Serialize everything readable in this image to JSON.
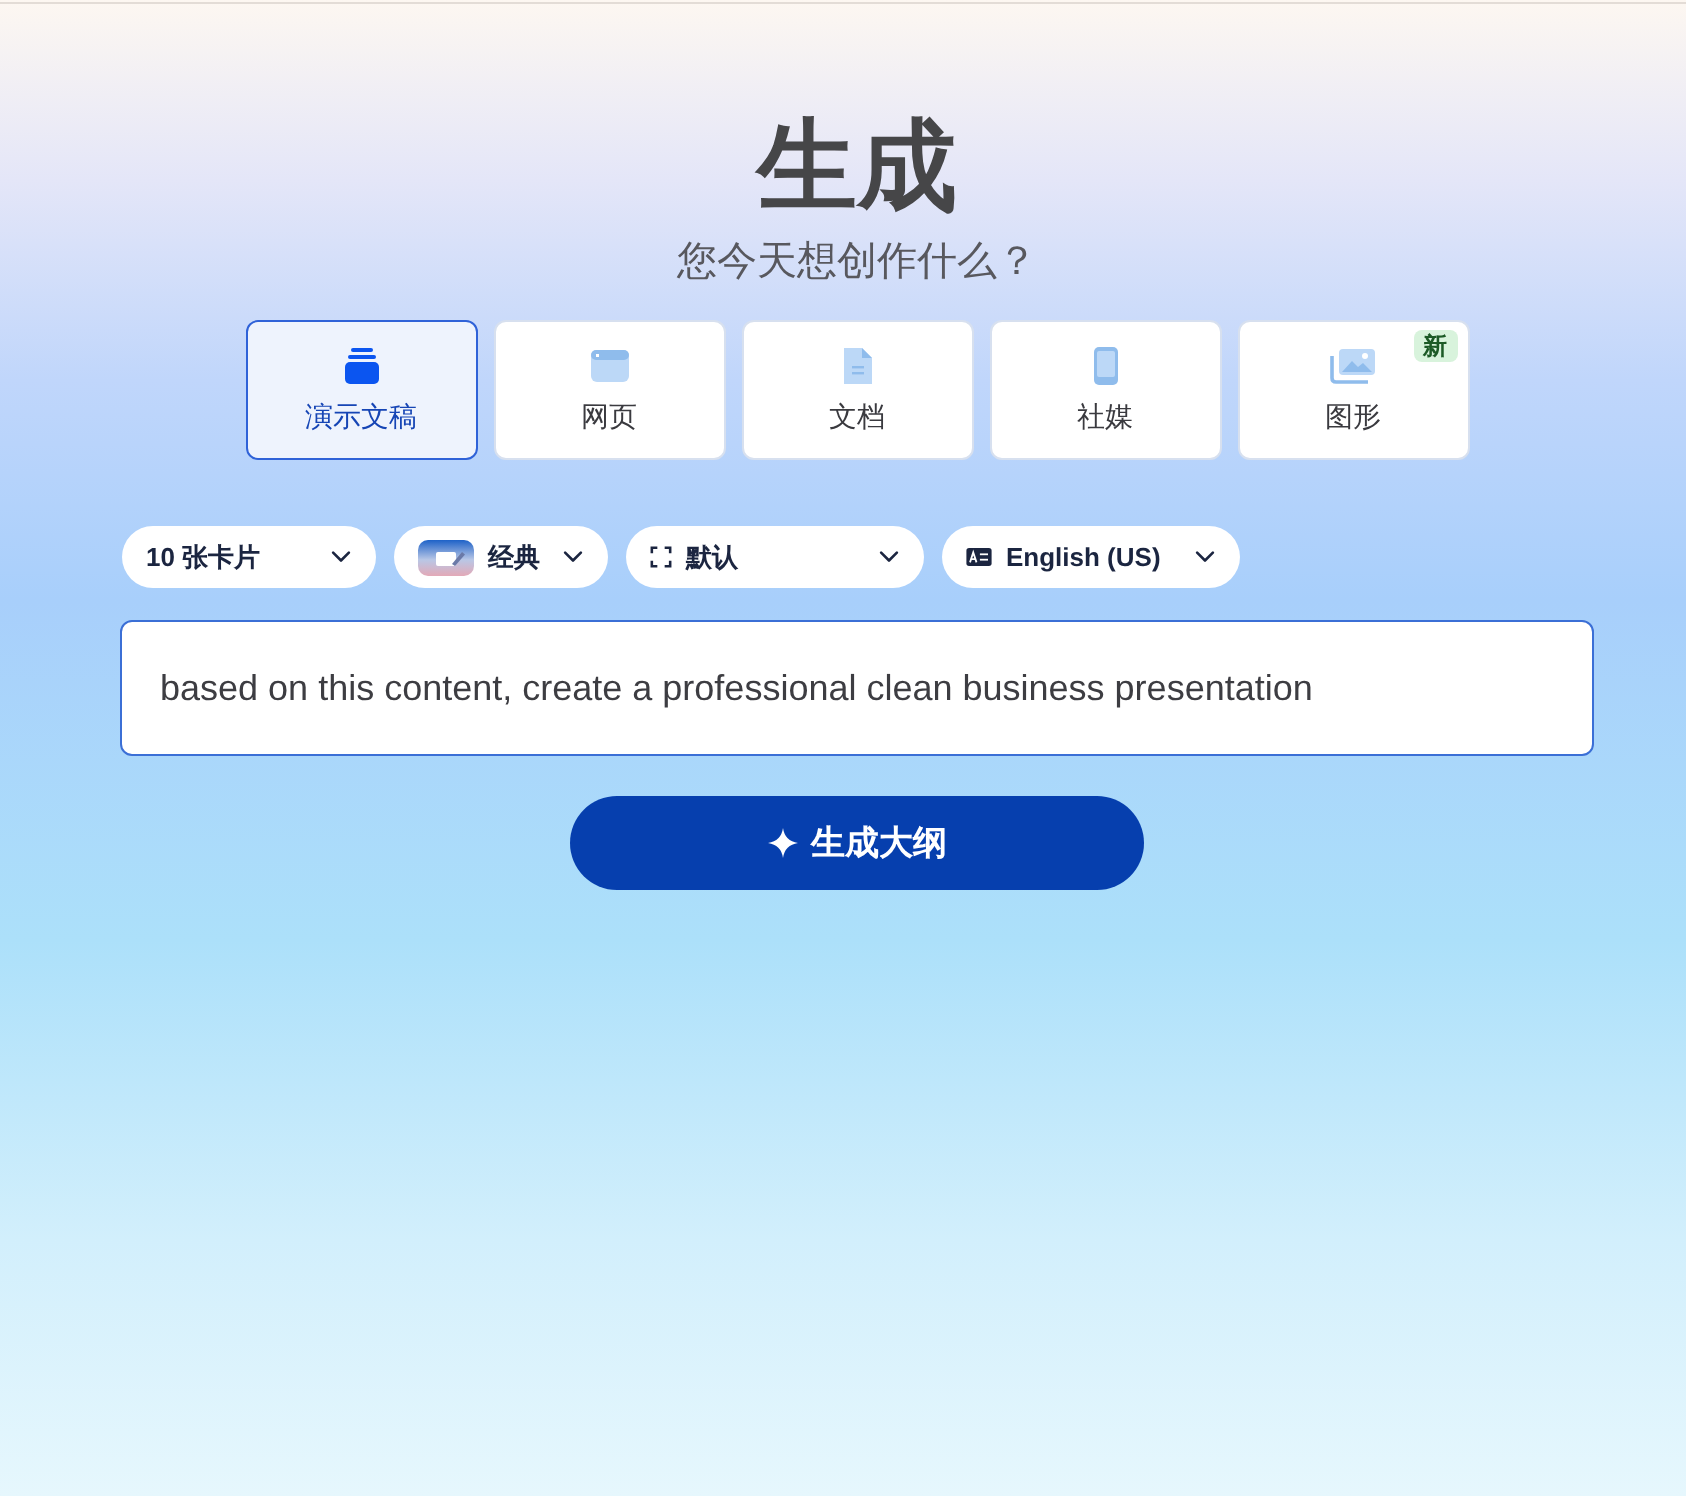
{
  "header": {
    "title": "生成",
    "subtitle": "您今天想创作什么？"
  },
  "tabs": [
    {
      "label": "演示文稿",
      "selected": true
    },
    {
      "label": "网页",
      "selected": false
    },
    {
      "label": "文档",
      "selected": false
    },
    {
      "label": "社媒",
      "selected": false
    },
    {
      "label": "图形",
      "selected": false,
      "badge": "新"
    }
  ],
  "options": [
    {
      "value": "10 张卡片"
    },
    {
      "value": "经典"
    },
    {
      "value": "默认"
    },
    {
      "value": "English (US)"
    }
  ],
  "prompt": {
    "value": "based on this content, create a professional clean business presentation"
  },
  "generate_button": {
    "label": "生成大纲"
  }
}
